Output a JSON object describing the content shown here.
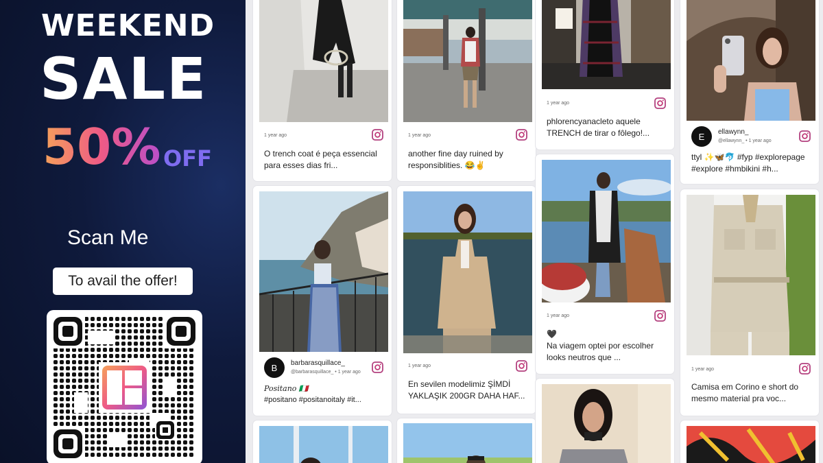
{
  "promo": {
    "headline_1": "WEEKEND",
    "headline_2": "SALE",
    "discount": "50%",
    "discount_suffix": "OFF",
    "scan": "Scan Me",
    "avail": "To avail the offer!"
  },
  "feed": {
    "cards": [
      {
        "time": "1 year ago",
        "caption_1": "O trench coat é peça essencial",
        "caption_2": "para esses dias fri..."
      },
      {
        "time": "1 year ago",
        "caption_1": "another fine day ruined by",
        "caption_2": "responsiblities. 😂✌"
      },
      {
        "time": "1 year ago",
        "caption_1": "phlorencyanacleto aquele",
        "caption_2": "TRENCH de tirar o fôlego!..."
      },
      {
        "avatar": "E",
        "user": "ellawynn_",
        "handle": "@ellawynn_ • 1 year ago",
        "caption_1": "ttyl ✨🦋🐬 #fyp #explorepage",
        "caption_2": "#explore #hmbikini #h..."
      },
      {
        "avatar": "B",
        "user": "barbarasquillace_",
        "handle": "@barbarasquillace_ • 1 year ago",
        "caption_1": "Positano 🇮🇹",
        "caption_2": "#positano #positanoitaly #it..."
      },
      {
        "time": "1 year ago",
        "caption_1": "En sevilen modelimiz ŞİMDİ",
        "caption_2": "YAKLAŞIK 200GR DAHA HAF..."
      },
      {
        "time": "1 year ago",
        "caption_1": "🖤",
        "caption_2": "Na viagem optei por escolher",
        "caption_3": "looks neutros que ..."
      },
      {
        "time": "1 year ago",
        "caption_1": "Camisa em Corino e short do",
        "caption_2": "mesmo material pra voc..."
      }
    ]
  },
  "colors": {
    "panel": "#0f1a3c",
    "ig_gradient_start": "#f5a15a",
    "ig_gradient_end": "#b94fc9"
  }
}
